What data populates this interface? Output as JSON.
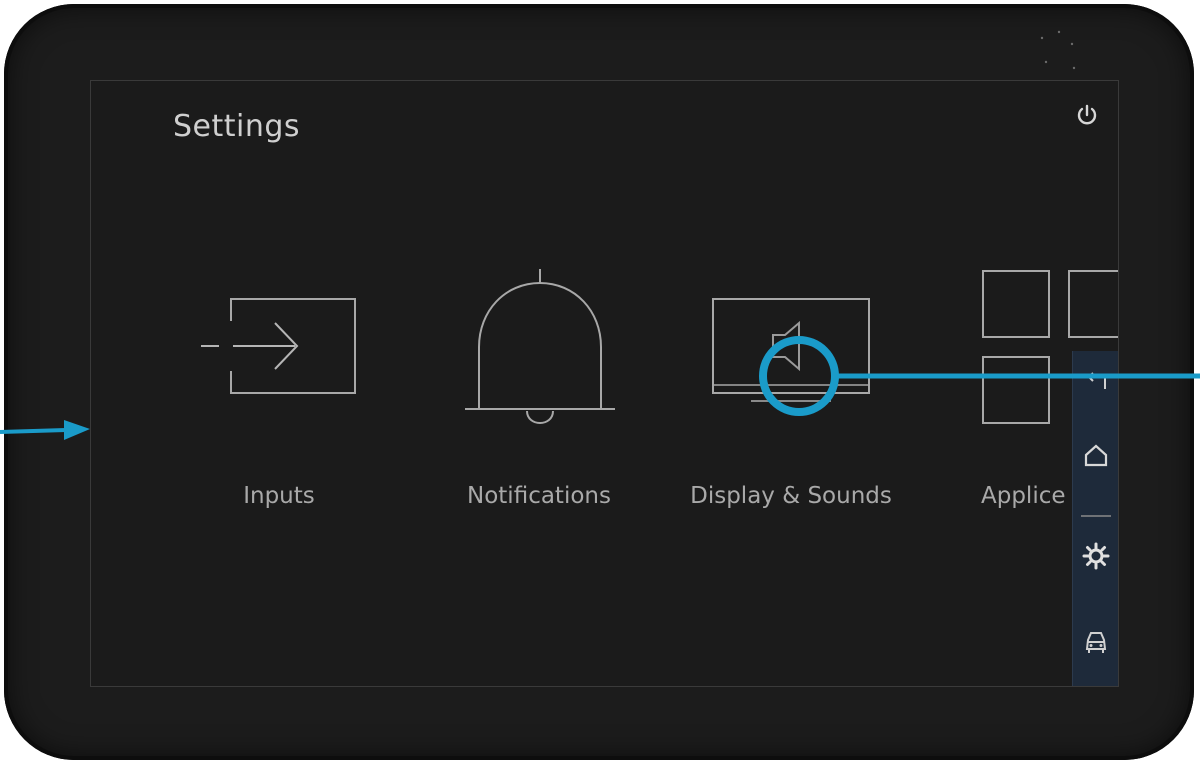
{
  "screen": {
    "title": "Settings"
  },
  "tiles": [
    {
      "label": "Inputs",
      "icon": "input-icon"
    },
    {
      "label": "Notifications",
      "icon": "bell-icon"
    },
    {
      "label": "Display & Sounds",
      "icon": "display-sound-icon"
    },
    {
      "label": "Applice",
      "icon": "apps-grid-icon"
    }
  ],
  "dock": {
    "icons": [
      "back-icon",
      "home-icon",
      "gear-icon",
      "car-icon"
    ]
  },
  "colors": {
    "accent": "#1a9bc9",
    "bezel": "#1c1c1c",
    "screen_bg": "#1b1b1b",
    "dock_bg": "#1e2a3a"
  }
}
